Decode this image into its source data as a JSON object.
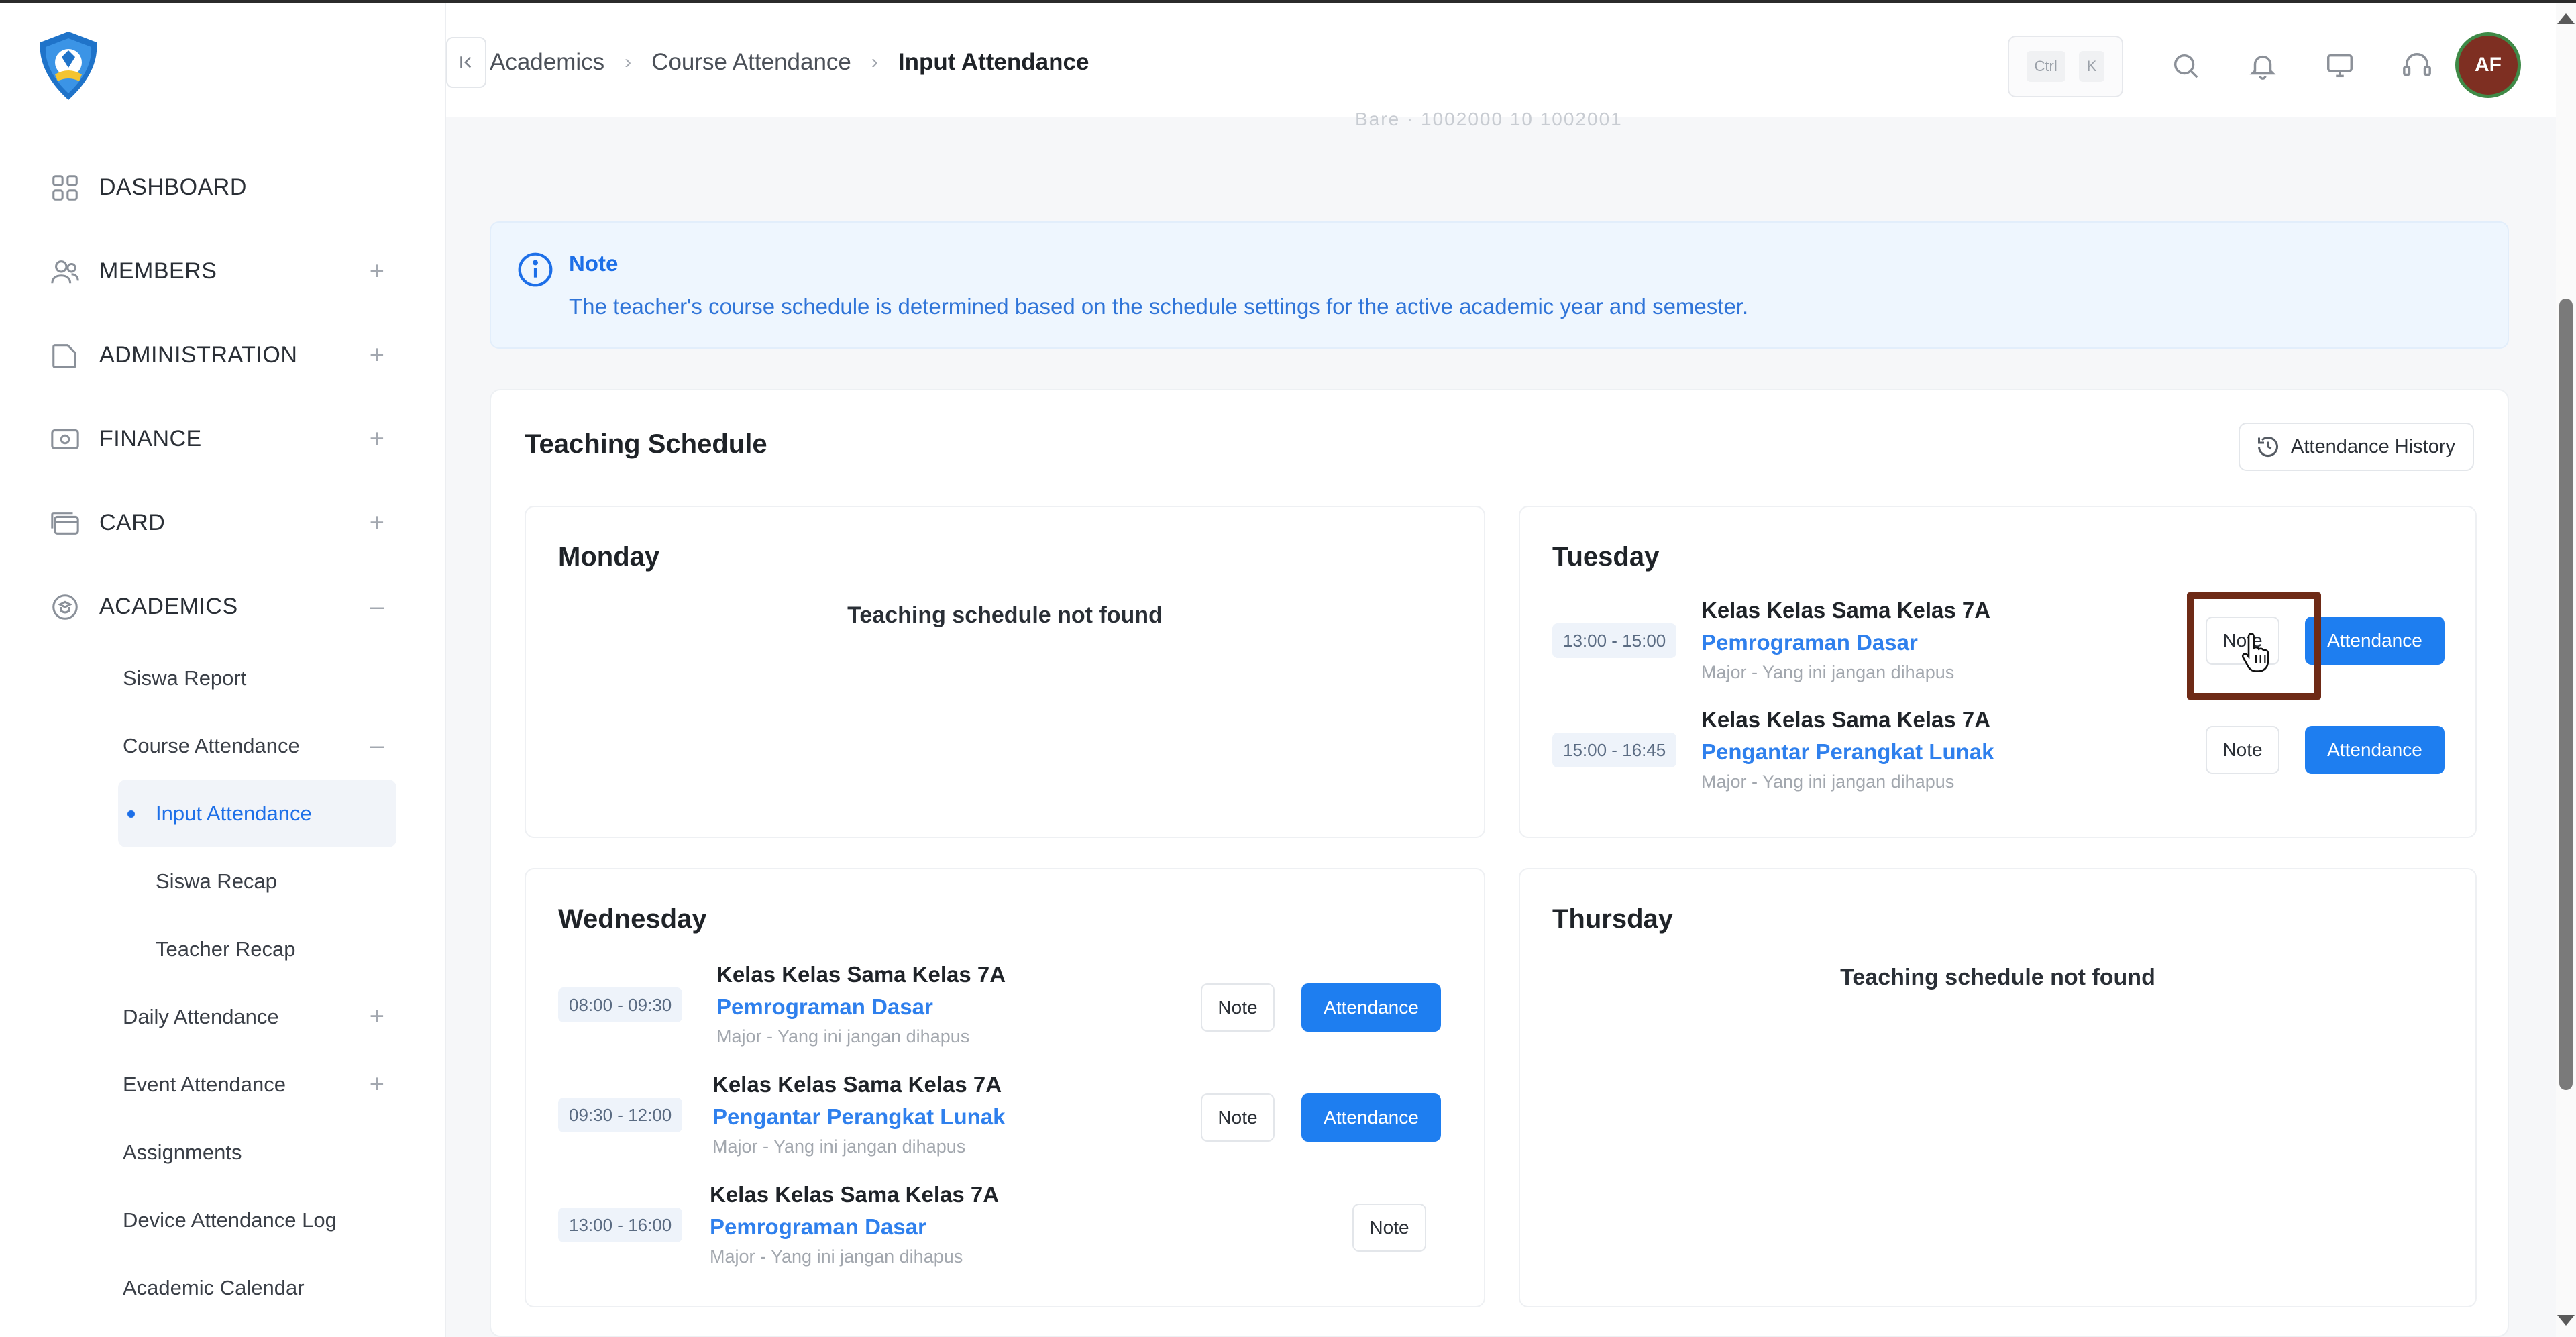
{
  "sidebar": {
    "logo": "tut-wuri-handayani-logo",
    "nav": [
      {
        "label": "DASHBOARD",
        "icon": "grid-icon",
        "toggle": ""
      },
      {
        "label": "MEMBERS",
        "icon": "users-icon",
        "toggle": "+"
      },
      {
        "label": "ADMINISTRATION",
        "icon": "folder-icon",
        "toggle": "+"
      },
      {
        "label": "FINANCE",
        "icon": "cash-icon",
        "toggle": "+"
      },
      {
        "label": "CARD",
        "icon": "card-icon",
        "toggle": "+"
      },
      {
        "label": "ACADEMICS",
        "icon": "academics-icon",
        "toggle": "–"
      }
    ],
    "academics_sub": [
      {
        "label": "Siswa Report",
        "toggle": ""
      },
      {
        "label": "Course Attendance",
        "toggle": "–"
      },
      {
        "label": "Input Attendance",
        "toggle": "",
        "active": true
      },
      {
        "label": "Siswa Recap",
        "toggle": ""
      },
      {
        "label": "Teacher Recap",
        "toggle": ""
      },
      {
        "label": "Daily Attendance",
        "toggle": "+"
      },
      {
        "label": "Event Attendance",
        "toggle": "+"
      },
      {
        "label": "Assignments",
        "toggle": ""
      },
      {
        "label": "Device Attendance Log",
        "toggle": ""
      },
      {
        "label": "Academic Calendar",
        "toggle": ""
      }
    ]
  },
  "header": {
    "breadcrumb": [
      "Academics",
      "Course Attendance",
      "Input Attendance"
    ],
    "shortcut": [
      "Ctrl",
      "K"
    ],
    "icons": [
      "search-icon",
      "bell-icon",
      "monitor-icon",
      "support-icon"
    ],
    "avatar_initials": "AF"
  },
  "faded_row": "Bare · 1002000 10 1002001",
  "note": {
    "title": "Note",
    "text": "The teacher's course schedule is determined based on the schedule settings for the active academic year and semester."
  },
  "schedule": {
    "title": "Teaching Schedule",
    "history_button": "Attendance History",
    "empty_message": "Teaching schedule not found",
    "days": {
      "monday": {
        "name": "Monday",
        "entries": []
      },
      "tuesday": {
        "name": "Tuesday",
        "entries": [
          {
            "time": "13:00 - 15:00",
            "class": "Kelas Kelas Sama Kelas 7A",
            "course": "Pemrograman Dasar",
            "major": "Major - Yang ini jangan dihapus",
            "note_label": "Note",
            "attendance_label": "Attendance"
          },
          {
            "time": "15:00 - 16:45",
            "class": "Kelas Kelas Sama Kelas 7A",
            "course": "Pengantar Perangkat Lunak",
            "major": "Major - Yang ini jangan dihapus",
            "note_label": "Note",
            "attendance_label": "Attendance"
          }
        ]
      },
      "wednesday": {
        "name": "Wednesday",
        "entries": [
          {
            "time": "08:00 - 09:30",
            "class": "Kelas Kelas Sama Kelas 7A",
            "course": "Pemrograman Dasar",
            "major": "Major - Yang ini jangan dihapus",
            "note_label": "Note",
            "attendance_label": "Attendance"
          },
          {
            "time": "09:30 - 12:00",
            "class": "Kelas Kelas Sama Kelas 7A",
            "course": "Pengantar Perangkat Lunak",
            "major": "Major - Yang ini jangan dihapus",
            "note_label": "Note",
            "attendance_label": "Attendance"
          },
          {
            "time": "13:00 - 16:00",
            "class": "Kelas Kelas Sama Kelas 7A",
            "course": "Pemrograman Dasar",
            "major": "Major - Yang ini jangan dihapus",
            "note_label": "Note",
            "attendance_label": ""
          }
        ]
      },
      "thursday": {
        "name": "Thursday",
        "entries": []
      }
    }
  },
  "colors": {
    "accent": "#1e7ef0",
    "highlight": "#6e2a16",
    "avatar": "#7e2f22"
  }
}
